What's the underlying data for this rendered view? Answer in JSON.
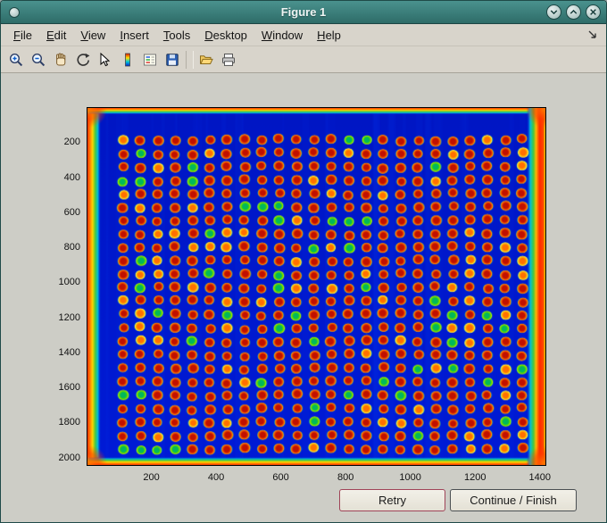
{
  "window": {
    "title": "Figure 1",
    "controls": [
      "shade",
      "maximize",
      "close"
    ]
  },
  "menu": {
    "items": [
      "File",
      "Edit",
      "View",
      "Insert",
      "Tools",
      "Desktop",
      "Window",
      "Help"
    ]
  },
  "toolbar": {
    "buttons": [
      "zoom-in",
      "zoom-out",
      "pan",
      "rotate-3d",
      "data-cursor",
      "insert-colorbar",
      "insert-legend",
      "save-figure",
      "open-file",
      "print-figure"
    ]
  },
  "figure": {
    "background_color": "#cdcdc6",
    "axes": {
      "x_ticks": [
        200,
        400,
        600,
        800,
        1000,
        1200,
        1400
      ],
      "y_ticks": [
        200,
        400,
        600,
        800,
        1000,
        1200,
        1400,
        1600,
        1800,
        2000
      ],
      "x_max": 1420,
      "y_max": 2048
    },
    "image": {
      "type": "image",
      "colormap": "jet",
      "grid_rows": 24,
      "grid_cols": 24,
      "colors": {
        "background": "#0017c8",
        "spot_core": "#c01000",
        "spot_mid": "#e84400",
        "spot_ring": "#ff9800",
        "edge_red": "#ff3000",
        "edge_yellow": "#ffd800",
        "edge_green": "#46c83c",
        "edge_cyan": "#00c0dc"
      }
    }
  },
  "buttons": {
    "retry": "Retry",
    "continue": "Continue / Finish"
  }
}
